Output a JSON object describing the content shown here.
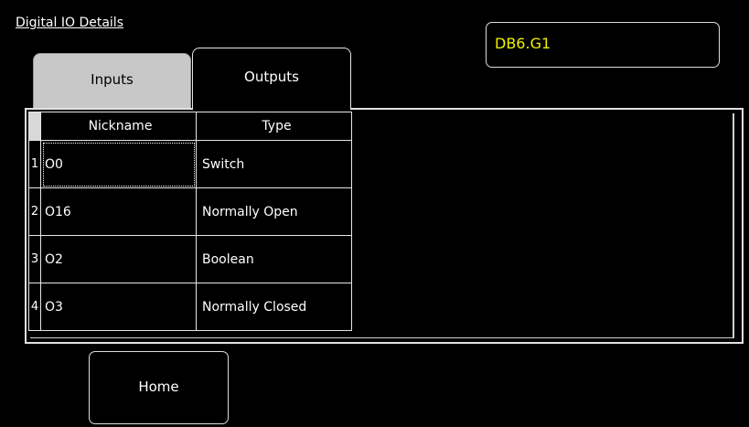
{
  "title": "Digital IO Details",
  "device": "DB6.G1",
  "tabs": [
    {
      "label": "Inputs",
      "active": false
    },
    {
      "label": "Outputs",
      "active": true
    }
  ],
  "table": {
    "columns": [
      "Nickname",
      "Type"
    ],
    "rows": [
      {
        "num": "1",
        "nickname": "O0",
        "type": "Switch"
      },
      {
        "num": "2",
        "nickname": "O16",
        "type": "Normally Open"
      },
      {
        "num": "3",
        "nickname": "O2",
        "type": "Boolean"
      },
      {
        "num": "4",
        "nickname": "O3",
        "type": "Normally Closed"
      }
    ]
  },
  "home_label": "Home",
  "colors": {
    "background": "#000000",
    "device_text": "#f2f200",
    "inactive_tab": "#c8c8c8"
  }
}
